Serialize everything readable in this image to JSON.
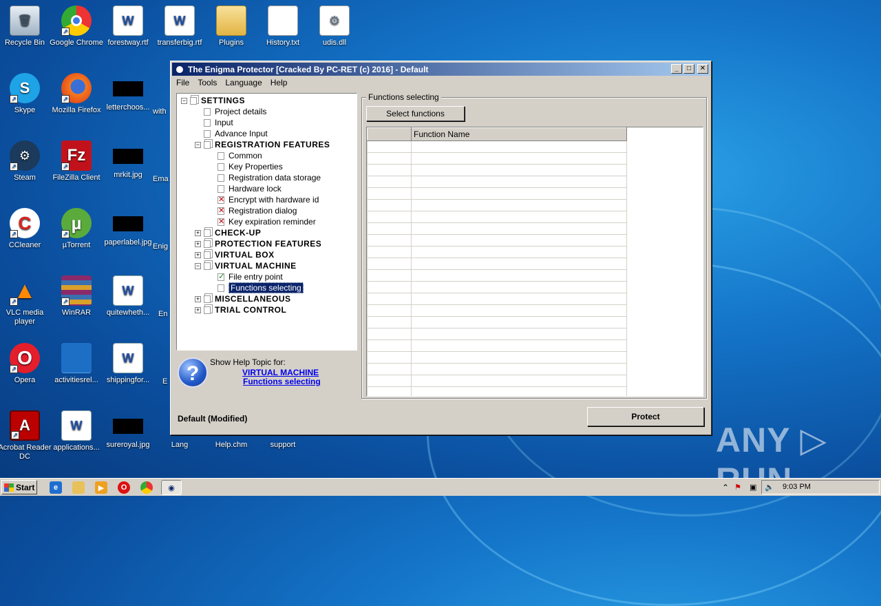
{
  "desktop": {
    "icons": [
      {
        "label": "Recycle Bin"
      },
      {
        "label": "Google Chrome"
      },
      {
        "label": "forestway.rtf"
      },
      {
        "label": "transferbig.rtf"
      },
      {
        "label": "Plugins"
      },
      {
        "label": "History.txt"
      },
      {
        "label": "udis.dll"
      },
      {
        "label": "Skype"
      },
      {
        "label": "Mozilla Firefox"
      },
      {
        "label": "letterchoos..."
      },
      {
        "label": "Steam"
      },
      {
        "label": "FileZilla Client"
      },
      {
        "label": "mrkit.jpg"
      },
      {
        "label": "CCleaner"
      },
      {
        "label": "µTorrent"
      },
      {
        "label": "paperlabel.jpg"
      },
      {
        "label": "VLC media player"
      },
      {
        "label": "WinRAR"
      },
      {
        "label": "quitewheth..."
      },
      {
        "label": "Opera"
      },
      {
        "label": "activitiesrel..."
      },
      {
        "label": "shippingfor..."
      },
      {
        "label": "Acrobat Reader DC"
      },
      {
        "label": "applications..."
      },
      {
        "label": "sureroyal.jpg"
      },
      {
        "label": "Lang"
      },
      {
        "label": "Help.chm"
      },
      {
        "label": "support"
      }
    ],
    "partial_labels": [
      "with",
      "Ema",
      "Enig",
      "En",
      "E"
    ]
  },
  "window": {
    "title": "The Enigma Protector [Cracked By PC-RET (c) 2016] - Default",
    "buttons": {
      "minimize": "_",
      "maximize": "□",
      "close": "✕"
    },
    "menu": [
      "File",
      "Tools",
      "Language",
      "Help"
    ],
    "tree": [
      {
        "label": "SETTINGS",
        "level": 0,
        "type": "head",
        "expander": "−"
      },
      {
        "label": "Project details",
        "level": 1,
        "type": "item"
      },
      {
        "label": "Input",
        "level": 1,
        "type": "item"
      },
      {
        "label": "Advance Input",
        "level": 1,
        "type": "item"
      },
      {
        "label": "REGISTRATION FEATURES",
        "level": 1,
        "type": "head",
        "expander": "−"
      },
      {
        "label": "Common",
        "level": 2,
        "type": "item"
      },
      {
        "label": "Key Properties",
        "level": 2,
        "type": "item"
      },
      {
        "label": "Registration data storage",
        "level": 2,
        "type": "item"
      },
      {
        "label": "Hardware lock",
        "level": 2,
        "type": "item"
      },
      {
        "label": "Encrypt with hardware id",
        "level": 2,
        "type": "x"
      },
      {
        "label": "Registration dialog",
        "level": 2,
        "type": "x"
      },
      {
        "label": "Key expiration reminder",
        "level": 2,
        "type": "x"
      },
      {
        "label": "CHECK-UP",
        "level": 1,
        "type": "head",
        "expander": "+"
      },
      {
        "label": "PROTECTION FEATURES",
        "level": 1,
        "type": "head",
        "expander": "+"
      },
      {
        "label": "VIRTUAL BOX",
        "level": 1,
        "type": "head",
        "expander": "+"
      },
      {
        "label": "VIRTUAL MACHINE",
        "level": 1,
        "type": "head",
        "expander": "−"
      },
      {
        "label": "File entry point",
        "level": 2,
        "type": "check"
      },
      {
        "label": "Functions selecting",
        "level": 2,
        "type": "selected"
      },
      {
        "label": "MISCELLANEOUS",
        "level": 1,
        "type": "head",
        "expander": "+"
      },
      {
        "label": "TRIAL CONTROL",
        "level": 1,
        "type": "head",
        "expander": "+"
      }
    ],
    "help": {
      "title": "Show Help Topic for:",
      "link1": "VIRTUAL MACHINE",
      "link2": "Functions selecting"
    },
    "panel": {
      "group_title": "Functions selecting",
      "select_button": "Select functions",
      "columns": [
        "",
        "Function Name"
      ],
      "row_count": 22
    },
    "status": "Default  (Modified)",
    "protect_button": "Protect"
  },
  "taskbar": {
    "start_label": "Start",
    "clock": "9:03 PM",
    "tray_arrow": "⌃"
  },
  "watermark": "ANY ▷ RUN"
}
